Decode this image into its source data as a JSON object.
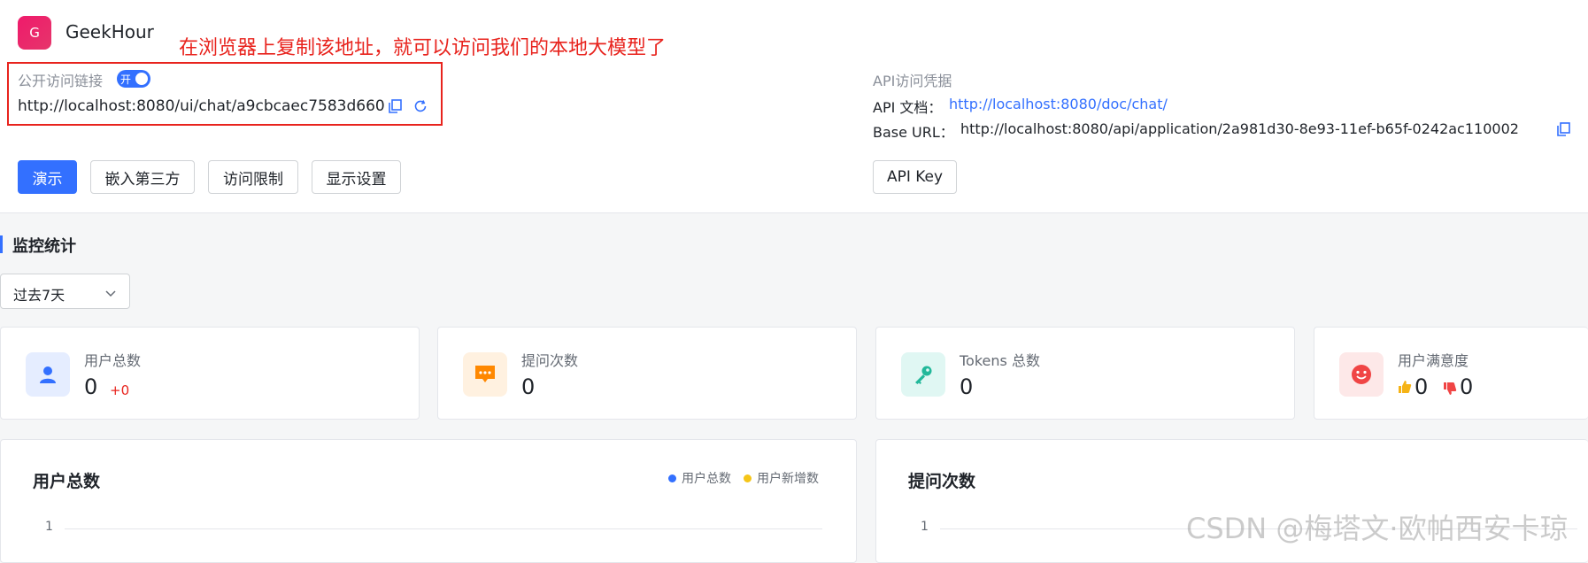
{
  "app": {
    "logo_letter": "G",
    "name": "GeekHour"
  },
  "annotation": {
    "text": "在浏览器上复制该地址，就可以访问我们的本地大模型了",
    "color": "#e8231d"
  },
  "public_access": {
    "label": "公开访问链接",
    "toggle_label": "开",
    "toggle_on": true,
    "url": "http://localhost:8080/ui/chat/a9cbcaec7583d660",
    "copy_icon": "copy-icon",
    "refresh_icon": "refresh-icon"
  },
  "actions": {
    "demo": "演示",
    "embed": "嵌入第三方",
    "access_limit": "访问限制",
    "display_settings": "显示设置"
  },
  "api": {
    "title": "API访问凭据",
    "doc_label": "API 文档：",
    "doc_link": "http://localhost:8080/doc/chat/",
    "base_url_label": "Base URL：",
    "base_url": "http://localhost:8080/api/application/2a981d30-8e93-11ef-b65f-0242ac110002",
    "api_key_button": "API Key"
  },
  "monitor": {
    "title": "监控统计",
    "period": "过去7天",
    "cards": [
      {
        "label": "用户总数",
        "value": "0",
        "delta": "+0",
        "icon": "user-icon"
      },
      {
        "label": "提问次数",
        "value": "0",
        "icon": "message-icon"
      },
      {
        "label": "Tokens 总数",
        "value": "0",
        "icon": "key-icon"
      },
      {
        "label": "用户满意度",
        "likes": "0",
        "dislikes": "0",
        "icon": "smile-icon"
      }
    ],
    "charts": [
      {
        "title": "用户总数",
        "legend": [
          "用户总数",
          "用户新增数"
        ],
        "y_tick": "1"
      },
      {
        "title": "提问次数",
        "y_tick": "1"
      }
    ]
  },
  "colors": {
    "accent": "#3370ff",
    "brand": "#ef1a6b",
    "legend_blue": "#3370ff",
    "legend_yellow": "#f5c518"
  },
  "watermark": "CSDN @梅塔文·欧帕西安卡琼"
}
